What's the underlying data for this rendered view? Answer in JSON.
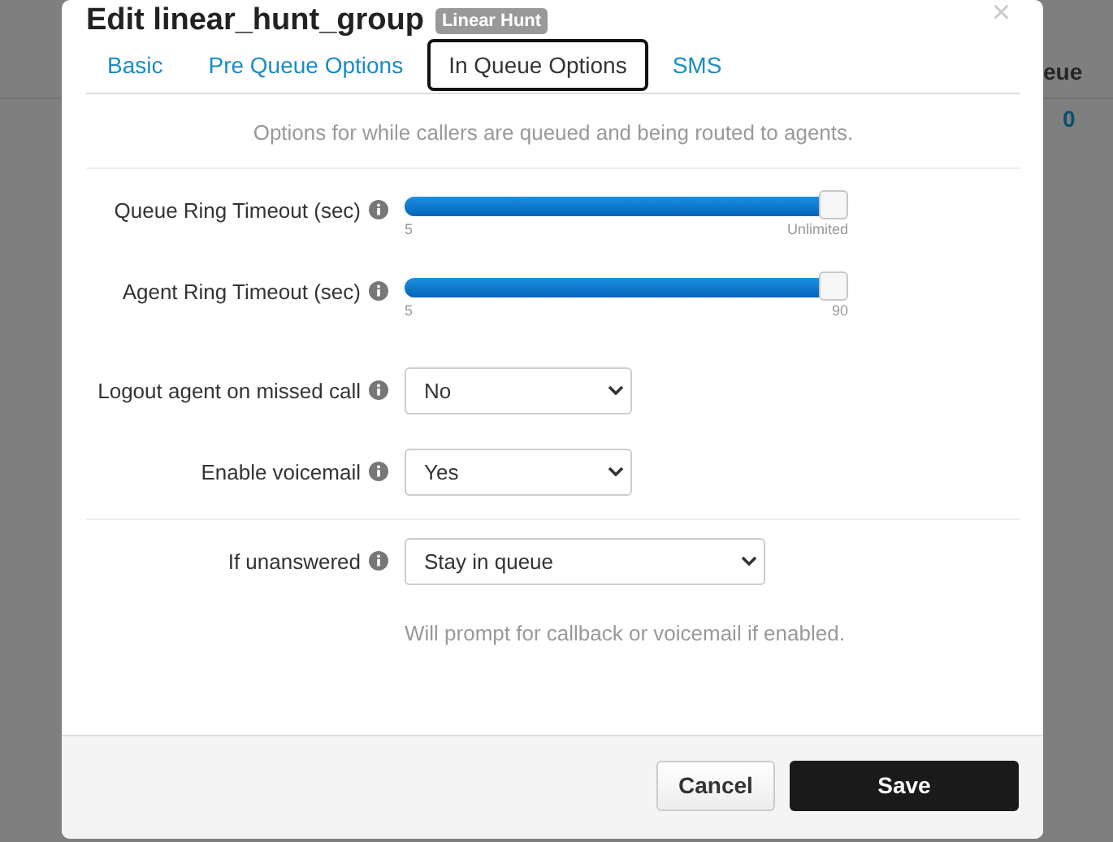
{
  "background": {
    "column_heading": "eue",
    "cell": "0"
  },
  "dialog": {
    "title": "Edit linear_hunt_group",
    "badge": "Linear Hunt",
    "close": "×"
  },
  "tabs": [
    {
      "label": "Basic",
      "selected": false
    },
    {
      "label": "Pre Queue Options",
      "selected": false
    },
    {
      "label": "In Queue Options",
      "selected": true
    },
    {
      "label": "SMS",
      "selected": false
    }
  ],
  "description": "Options for while callers are queued and being routed to agents.",
  "sections": [
    {
      "fields": [
        {
          "kind": "slider",
          "label": "Queue Ring Timeout (sec)",
          "level": 1,
          "min_label": "5",
          "max_label": "Unlimited"
        },
        {
          "kind": "slider",
          "label": "Agent Ring Timeout (sec)",
          "level": 1,
          "min_label": "5",
          "max_label": "90"
        },
        {
          "kind": "select",
          "label": "Logout agent on missed call",
          "value": "No"
        },
        {
          "kind": "select",
          "label": "Enable voicemail",
          "value": "Yes"
        }
      ]
    },
    {
      "fields": [
        {
          "kind": "select",
          "label": "If unanswered",
          "value": "Stay in queue"
        }
      ],
      "hint": "Will prompt for callback or voicemail if enabled."
    }
  ],
  "buttons": [
    {
      "label": "Cancel",
      "kind": "secondary"
    },
    {
      "label": "Save",
      "kind": "primary"
    }
  ]
}
